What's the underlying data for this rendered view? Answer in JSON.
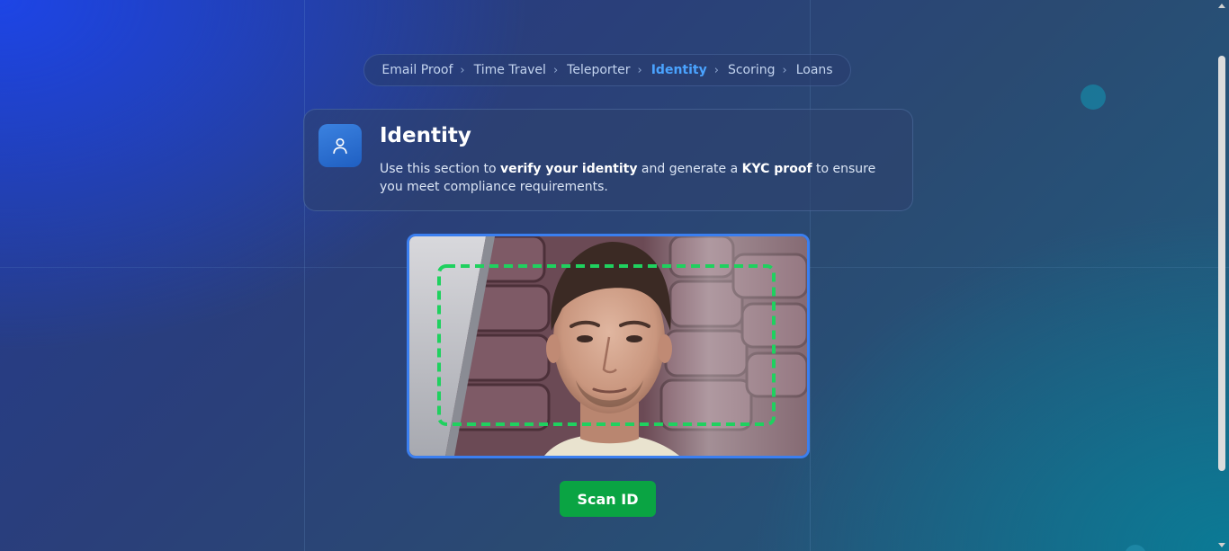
{
  "breadcrumb": {
    "items": [
      {
        "label": "Email Proof",
        "active": false
      },
      {
        "label": "Time Travel",
        "active": false
      },
      {
        "label": "Teleporter",
        "active": false
      },
      {
        "label": "Identity",
        "active": true
      },
      {
        "label": "Scoring",
        "active": false
      },
      {
        "label": "Loans",
        "active": false
      }
    ],
    "separator": "›"
  },
  "section": {
    "icon": "user-icon",
    "title": "Identity",
    "desc_part1": "Use this section to ",
    "desc_bold1": "verify your identity",
    "desc_part2": " and generate a ",
    "desc_bold2": "KYC proof",
    "desc_part3": " to ensure you meet compliance requirements."
  },
  "camera": {
    "icon": "camera-feed",
    "frame_color": "#3b7ff0",
    "scan_box_color": "#1fd15f"
  },
  "actions": {
    "scan_label": "Scan ID"
  },
  "colors": {
    "accent": "#4aa3ff",
    "button": "#0aa443"
  }
}
